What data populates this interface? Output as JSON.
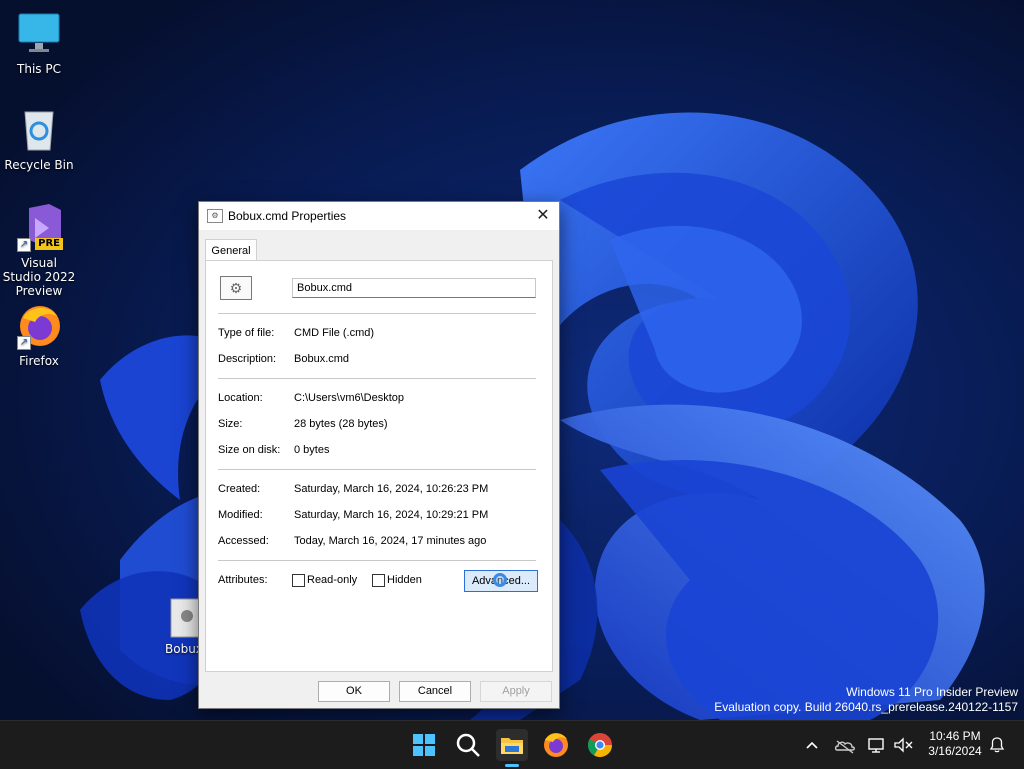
{
  "desktop": {
    "icons": [
      {
        "label": "This PC"
      },
      {
        "label": "Recycle Bin"
      },
      {
        "label": "Visual Studio 2022 Preview",
        "badge": "PRE"
      },
      {
        "label": "Firefox"
      }
    ],
    "partial_file_label": "Bobux"
  },
  "watermark": {
    "line1": "Windows 11 Pro Insider Preview",
    "line2": "Evaluation copy. Build 26040.rs_prerelease.240122-1157"
  },
  "dialog": {
    "title": "Bobux.cmd Properties",
    "close_glyph": "✕",
    "tab_label": "General",
    "filename": "Bobux.cmd",
    "fields": {
      "type_label": "Type of file:",
      "type_value": "CMD File (.cmd)",
      "desc_label": "Description:",
      "desc_value": "Bobux.cmd",
      "location_label": "Location:",
      "location_value": "C:\\Users\\vm6\\Desktop",
      "size_label": "Size:",
      "size_value": "28 bytes (28 bytes)",
      "size_disk_label": "Size on disk:",
      "size_disk_value": "0 bytes",
      "created_label": "Created:",
      "created_value": "Saturday, March 16, 2024, 10:26:23 PM",
      "modified_label": "Modified:",
      "modified_value": "Saturday, March 16, 2024, 10:29:21 PM",
      "accessed_label": "Accessed:",
      "accessed_value": "Today, March 16, 2024, 17 minutes ago"
    },
    "attributes_label": "Attributes:",
    "readonly_label": "Read-only",
    "hidden_label": "Hidden",
    "advanced_label": "Advanced...",
    "ok_label": "OK",
    "cancel_label": "Cancel",
    "apply_label": "Apply"
  },
  "taskbar": {
    "apps": [
      "start-icon",
      "search-icon",
      "file-explorer-icon",
      "firefox-icon",
      "chrome-icon"
    ],
    "time": "10:46 PM",
    "date": "3/16/2024"
  },
  "colors": {
    "accent": "#2d6fd8",
    "taskbar": "#1c1c1c"
  }
}
